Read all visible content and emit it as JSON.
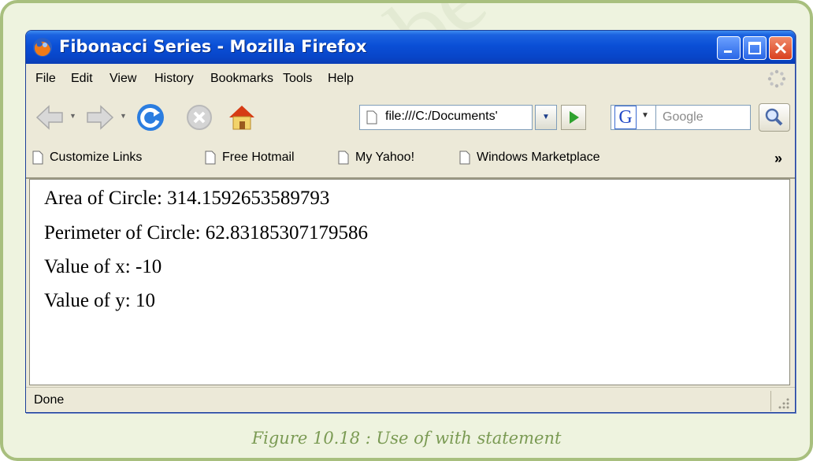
{
  "window": {
    "title": "Fibonacci Series - Mozilla Firefox",
    "controls": {
      "minimize": "minimize-icon",
      "maximize": "maximize-icon",
      "close": "close-icon"
    }
  },
  "menu": {
    "items": [
      "File",
      "Edit",
      "View",
      "History",
      "Bookmarks",
      "Tools",
      "Help"
    ]
  },
  "navigation": {
    "address": "file:///C:/Documents'",
    "search_engine": "G",
    "search_placeholder": "Google",
    "icons": [
      "back-arrow-icon",
      "forward-arrow-icon",
      "reload-icon",
      "stop-icon",
      "home-icon",
      "go-icon",
      "search-magnifier-icon"
    ]
  },
  "bookmarks": {
    "links": [
      "Customize Links",
      "Free Hotmail",
      "My Yahoo!",
      "Windows Marketplace"
    ],
    "overflow": "»"
  },
  "content": {
    "lines": [
      "Area of Circle: 314.1592653589793",
      "Perimeter of Circle: 62.83185307179586",
      "Value of x: -10",
      "Value of y: 10"
    ]
  },
  "status": {
    "text": "Done"
  },
  "caption": "Figure 10.18 : Use of with statement",
  "colors": {
    "titlebar": "#0a4fd6",
    "frame_border": "#a8bf7e",
    "caption": "#7a9a53",
    "chrome": "#ece9d8"
  }
}
